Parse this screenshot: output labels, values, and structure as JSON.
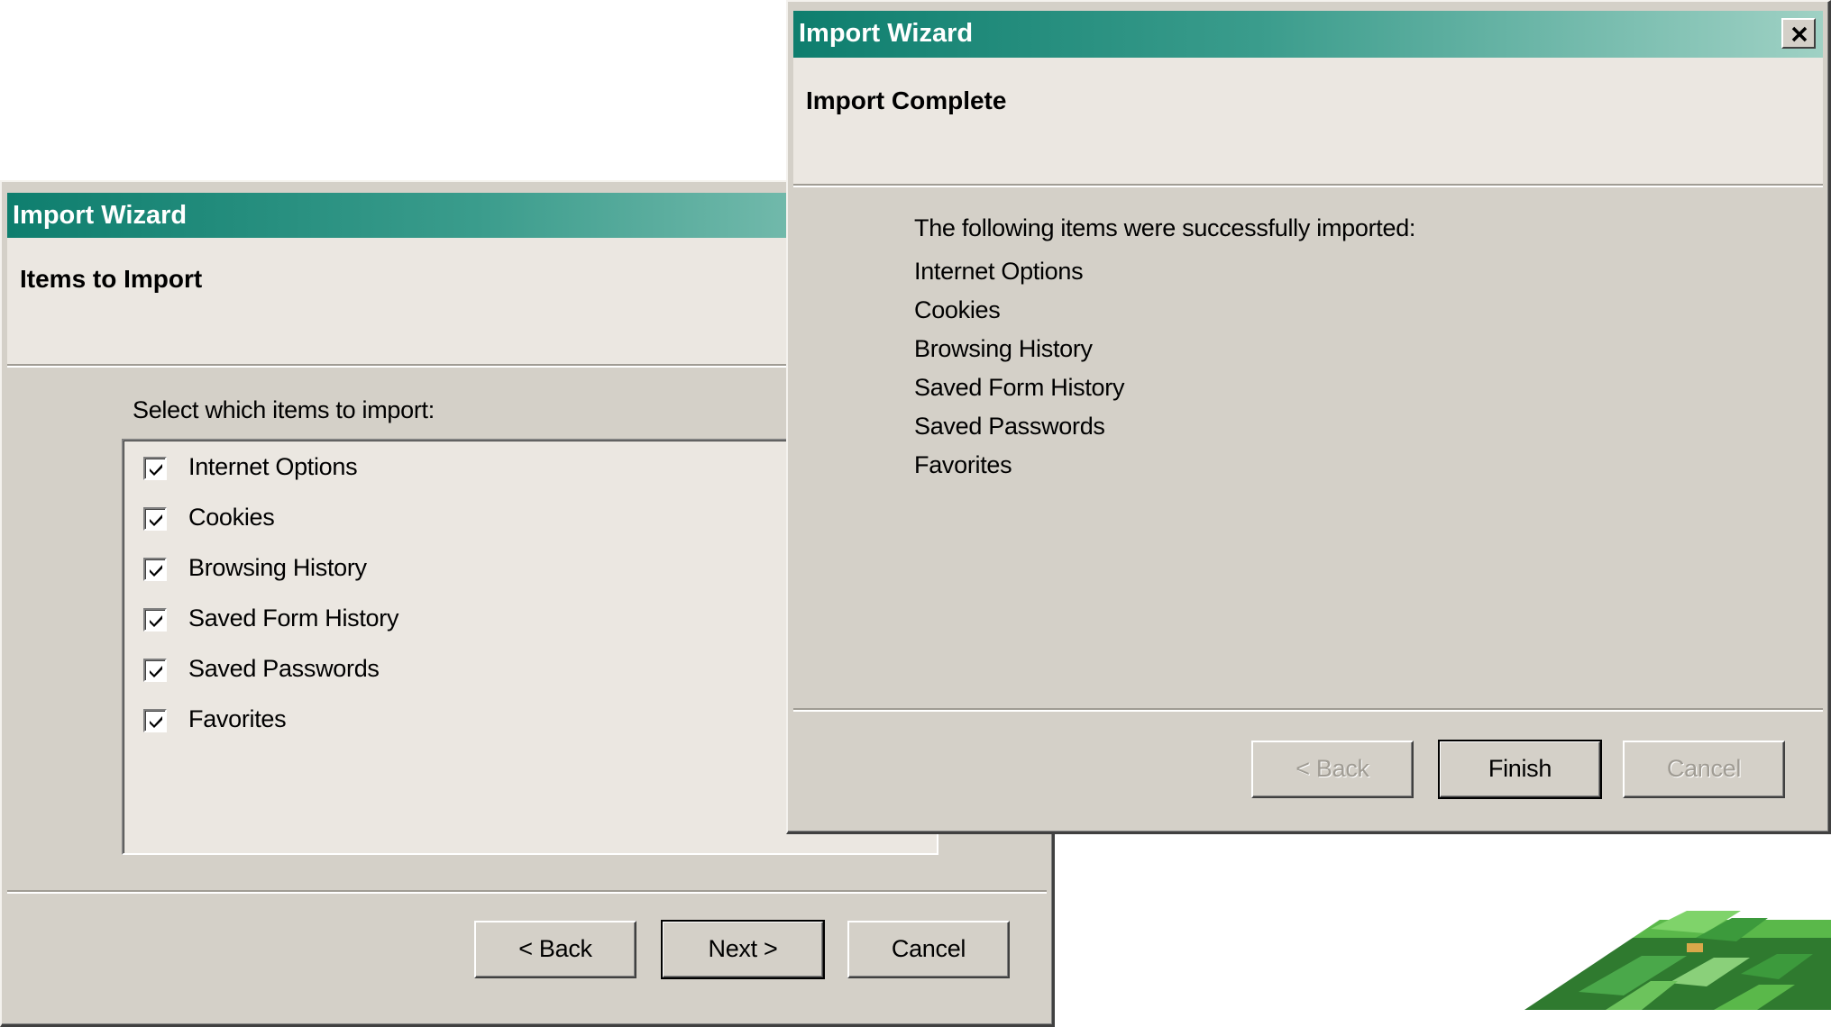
{
  "back_dialog": {
    "title": "Import Wizard",
    "header": "Items to Import",
    "prompt": "Select which items to import:",
    "items": [
      {
        "label": "Internet Options",
        "checked": true
      },
      {
        "label": "Cookies",
        "checked": true
      },
      {
        "label": "Browsing History",
        "checked": true
      },
      {
        "label": "Saved Form History",
        "checked": true
      },
      {
        "label": "Saved Passwords",
        "checked": true
      },
      {
        "label": "Favorites",
        "checked": true
      }
    ],
    "buttons": {
      "back": "< Back",
      "next": "Next >",
      "cancel": "Cancel"
    }
  },
  "front_dialog": {
    "title": "Import Wizard",
    "header": "Import Complete",
    "message": "The following items were successfully imported:",
    "items": [
      "Internet Options",
      "Cookies",
      "Browsing History",
      "Saved Form History",
      "Saved Passwords",
      "Favorites"
    ],
    "buttons": {
      "back": "< Back",
      "finish": "Finish",
      "cancel": "Cancel"
    },
    "close_icon": "close-icon"
  },
  "colors": {
    "titlebar_start": "#0e7e6e",
    "titlebar_end": "#9fd1c4",
    "dialog_face": "#d4d0c8",
    "panel": "#ebe7e1"
  }
}
